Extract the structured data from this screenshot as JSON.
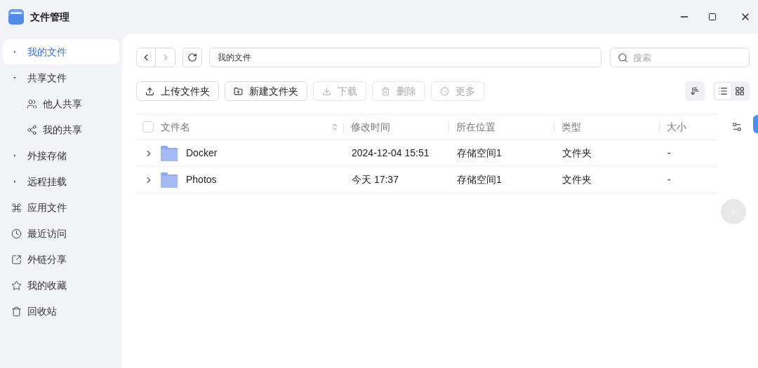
{
  "window": {
    "title": "文件管理"
  },
  "sidebar": {
    "items": [
      {
        "kind": "group",
        "label": "我的文件",
        "selected": true,
        "expanded": false
      },
      {
        "kind": "group",
        "label": "共享文件",
        "selected": false,
        "expanded": true,
        "children": [
          {
            "kind": "link",
            "label": "他人共享",
            "selected": false
          },
          {
            "kind": "link",
            "label": "我的共享",
            "selected": false
          }
        ]
      },
      {
        "kind": "group",
        "label": "外接存储",
        "selected": false,
        "expanded": false
      },
      {
        "kind": "group",
        "label": "远程挂载",
        "selected": false,
        "expanded": false
      },
      {
        "kind": "link",
        "label": "应用文件",
        "selected": false
      },
      {
        "kind": "link",
        "label": "最近访问",
        "selected": false
      },
      {
        "kind": "link",
        "label": "外链分享",
        "selected": false
      },
      {
        "kind": "link",
        "label": "我的收藏",
        "selected": false
      },
      {
        "kind": "link",
        "label": "回收站",
        "selected": false
      }
    ]
  },
  "navigation": {
    "back_disabled": false,
    "forward_disabled": true,
    "path": "我的文件",
    "search": {
      "placeholder": "搜索"
    }
  },
  "toolbar": [
    {
      "label": "上传文件夹",
      "disabled": false
    },
    {
      "label": "新建文件夹",
      "disabled": false
    },
    {
      "label": "下载",
      "disabled": true
    },
    {
      "label": "删除",
      "disabled": true
    },
    {
      "label": "更多",
      "disabled": true
    }
  ],
  "view_modes": [
    {
      "kind": "list",
      "selected": true
    },
    {
      "kind": "grid",
      "selected": false
    }
  ],
  "table": {
    "select_all": {
      "checked": false
    },
    "columns": [
      "文件名",
      "修改时间",
      "所在位置",
      "类型",
      "大小"
    ],
    "rows": [
      {
        "name": "Docker",
        "modified": "2024-12-04 15:51",
        "location": "存储空间1",
        "type": "文件夹",
        "size": "-"
      },
      {
        "name": "Photos",
        "modified": "今天 17:37",
        "location": "存储空间1",
        "type": "文件夹",
        "size": "-"
      }
    ]
  }
}
